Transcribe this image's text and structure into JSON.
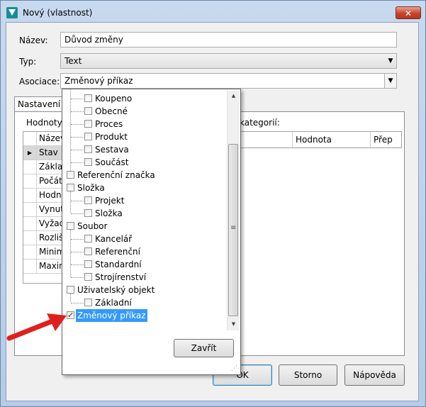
{
  "window": {
    "title": "Nový (vlastnost)",
    "close_glyph": "✕",
    "icon": "app-logo-icon"
  },
  "form": {
    "name_label": "Název:",
    "name_value": "Důvod změny",
    "type_label": "Typ:",
    "type_value": "Text",
    "assoc_label": "Asociace:",
    "assoc_value": "Změnový příkaz"
  },
  "tabs": {
    "settings_label": "Nastavení"
  },
  "panel": {
    "values_label": "Hodnoty",
    "categories_label": "kategorií:",
    "left_grid": {
      "header": "Název",
      "rows": [
        "Stav",
        "Základ",
        "Počát",
        "Hodn",
        "Vynut",
        "Vyžad",
        "Rozliš",
        "Minim",
        "Maxin"
      ]
    },
    "right_grid": {
      "headers": [
        "Hodnota",
        "Přep"
      ]
    }
  },
  "buttons": {
    "ok": "OK",
    "cancel": "Storno",
    "help": "Nápověda"
  },
  "dropdown": {
    "items": [
      {
        "label": "Koupeno",
        "level": 1,
        "checked": false
      },
      {
        "label": "Obecné",
        "level": 1,
        "checked": false
      },
      {
        "label": "Proces",
        "level": 1,
        "checked": false
      },
      {
        "label": "Produkt",
        "level": 1,
        "checked": false
      },
      {
        "label": "Sestava",
        "level": 1,
        "checked": false
      },
      {
        "label": "Součást",
        "level": 1,
        "checked": false
      },
      {
        "label": "Referenční značka",
        "level": 0,
        "checked": false
      },
      {
        "label": "Složka",
        "level": 0,
        "checked": false
      },
      {
        "label": "Projekt",
        "level": 1,
        "checked": false
      },
      {
        "label": "Složka",
        "level": 1,
        "checked": false
      },
      {
        "label": "Soubor",
        "level": 0,
        "checked": false
      },
      {
        "label": "Kancelář",
        "level": 1,
        "checked": false
      },
      {
        "label": "Referenční",
        "level": 1,
        "checked": false
      },
      {
        "label": "Standardní",
        "level": 1,
        "checked": false
      },
      {
        "label": "Strojírenství",
        "level": 1,
        "checked": false
      },
      {
        "label": "Uživatelský objekt",
        "level": 0,
        "checked": false
      },
      {
        "label": "Základní",
        "level": 1,
        "checked": false
      },
      {
        "label": "Změnový příkaz",
        "level": 0,
        "checked": true,
        "selected": true
      }
    ],
    "close_label": "Zavřít"
  },
  "colors": {
    "selection": "#3399ff",
    "arrow": "#e0201c",
    "close_button": "#c7452e"
  }
}
